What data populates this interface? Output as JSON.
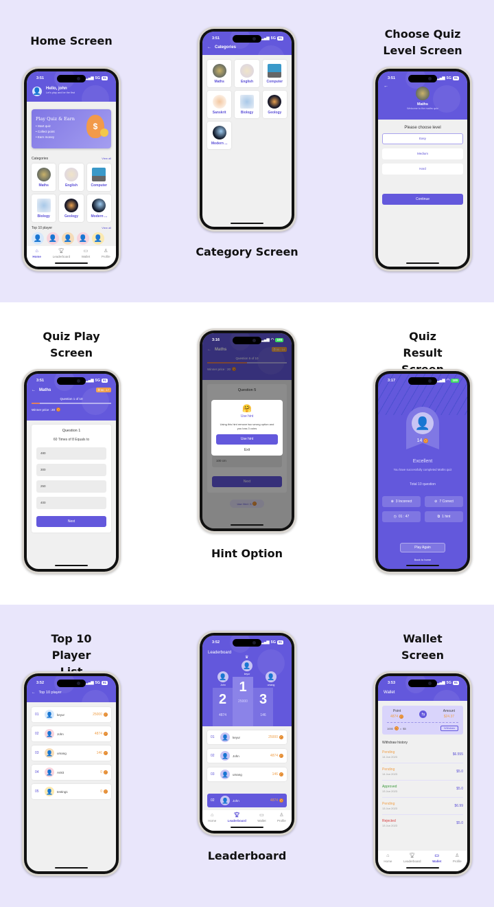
{
  "colors": {
    "primary": "#6358dc",
    "coin": "#f0a04a",
    "pending": "#f0a04a",
    "approved": "#3c9a3c",
    "rejected": "#d63c3c"
  },
  "captions": {
    "home": "Home Screen",
    "category": "Category Screen",
    "level": "Choose Quiz Level Screen",
    "play": "Quiz Play Screen",
    "hint": "Hint Option",
    "result": "Quiz Result Screen",
    "top10": "Top 10 Player List",
    "leaderboard": "Leaderboard",
    "wallet": "Wallet Screen"
  },
  "home": {
    "time": "3:51",
    "signal": "5G",
    "battery": "91",
    "greeting": "Hello, john",
    "subtitle": "Let's play and be the first",
    "banner": {
      "title": "Play Quiz & Earn",
      "items": [
        "Start quiz",
        "Collect point",
        "Earn money"
      ]
    },
    "categories_title": "Categories",
    "view_all": "View all",
    "categories": [
      "Maths",
      "English",
      "Computer",
      "Biology",
      "Geology",
      "Modern ..."
    ],
    "top_players_title": "Top 10 player",
    "top_view_all": "View all"
  },
  "tabs": [
    {
      "label": "Home",
      "icon": "home-icon"
    },
    {
      "label": "Leaderboard",
      "icon": "trophy-icon"
    },
    {
      "label": "Wallet",
      "icon": "wallet-icon"
    },
    {
      "label": "Profile",
      "icon": "user-icon"
    }
  ],
  "category_screen": {
    "time": "3:51",
    "signal": "5G",
    "battery": "91",
    "title": "Categories",
    "categories": [
      "Maths",
      "English",
      "Computer",
      "Sanskrit",
      "Biology",
      "Geology",
      "Modern ..."
    ]
  },
  "level_screen": {
    "time": "3:51",
    "signal": "5G",
    "battery": "91",
    "subject": "Maths",
    "welcome": "Welcome to the maths quiz",
    "prompt": "Please choose level",
    "levels": [
      "Easy",
      "Medium",
      "Hard"
    ],
    "selected": "Easy",
    "continue": "Continue"
  },
  "play_screen": {
    "time": "3:51",
    "signal": "5G",
    "battery": "91",
    "title": "Maths",
    "timer": "00 : 17",
    "progress_text": "Question 1 of 10",
    "progress": 0.1,
    "winner_prize": "Winner price : 20",
    "question_title": "Question 1",
    "question": "60 Times of 8 Equals to",
    "options": [
      "480",
      "300",
      "250",
      "400"
    ],
    "next": "Next"
  },
  "hint_screen": {
    "time": "3:16",
    "battery": "100",
    "title": "Maths",
    "timer": "00 : 14",
    "progress_text": "Question 5 of 10",
    "progress": 0.5,
    "winner_prize": "Winner price : 20",
    "question_title": "Question 5",
    "visible_option": "100 cm",
    "next": "Next",
    "hint_badge": "Use Hint / 3",
    "dialog": {
      "title": "Use hint",
      "body": "Using this hint remove two wrong option and you loss 3 coins",
      "confirm": "Use hint",
      "exit": "Exit"
    }
  },
  "result_screen": {
    "time": "3:17",
    "battery": "100",
    "score": "14",
    "headline": "Excellent",
    "message": "You have successfully completed Maths quiz",
    "total": "Total 10 question",
    "stats": [
      {
        "icon": "x-circle-icon",
        "label": "3 Incorrect"
      },
      {
        "icon": "check-circle-icon",
        "label": "7 Correct"
      },
      {
        "icon": "clock-icon",
        "label": "01 : 47"
      },
      {
        "icon": "hint-icon",
        "label": "1 hint"
      }
    ],
    "play_again": "Play Again",
    "back_home": "Back to home"
  },
  "top10_screen": {
    "time": "3:52",
    "signal": "5G",
    "battery": "91",
    "title": "Top 10 player",
    "players": [
      {
        "rank": "01",
        "name": "keyur",
        "score": "25000",
        "bg": "#d6e8fb"
      },
      {
        "rank": "02",
        "name": "John",
        "score": "4874",
        "bg": "#f7d3dc"
      },
      {
        "rank": "03",
        "name": "umang",
        "score": "146",
        "bg": "#f5dcb8"
      },
      {
        "rank": "04",
        "name": "Ankit",
        "score": "0",
        "bg": "#f7d3dc"
      },
      {
        "rank": "05",
        "name": "testing1",
        "score": "0",
        "bg": "#fbe9b0"
      }
    ]
  },
  "leaderboard_screen": {
    "time": "3:52",
    "signal": "5G",
    "battery": "91",
    "title": "Leaderboard",
    "podium": [
      {
        "place": "2",
        "name": "John",
        "score": "4874"
      },
      {
        "place": "1",
        "name": "keyur",
        "score": "25000"
      },
      {
        "place": "3",
        "name": "umang",
        "score": "146"
      }
    ],
    "list": [
      {
        "rank": "01",
        "name": "keyur",
        "score": "25000"
      },
      {
        "rank": "02",
        "name": "John",
        "score": "4874"
      },
      {
        "rank": "03",
        "name": "umang",
        "score": "146"
      }
    ],
    "me": {
      "rank": "02",
      "name": "John",
      "score": "4874"
    }
  },
  "wallet_screen": {
    "time": "3:53",
    "signal": "5G",
    "battery": "91",
    "title": "Wallet",
    "point_label": "Point",
    "points": "4874",
    "amount_label": "Amount",
    "amount": "$24.37",
    "rate_points": "1000",
    "rate_eq": "=",
    "rate_value": "$5",
    "withdraw": "Withdraw",
    "history_title": "Withdraw history",
    "history": [
      {
        "status": "Pending",
        "date": "14 Jun 2023",
        "amount": "$6.555",
        "kind": "pending"
      },
      {
        "status": "Pending",
        "date": "14 Jun 2023",
        "amount": "$5.0",
        "kind": "pending"
      },
      {
        "status": "Approved",
        "date": "13 Jun 2023",
        "amount": "$5.0",
        "kind": "approved"
      },
      {
        "status": "Pending",
        "date": "13 Jun 2023",
        "amount": "$6.99",
        "kind": "pending"
      },
      {
        "status": "Rejected",
        "date": "13 Jun 2023",
        "amount": "$5.0",
        "kind": "rejected"
      }
    ]
  }
}
